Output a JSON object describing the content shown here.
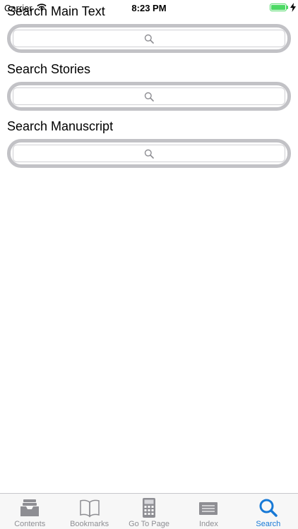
{
  "status_bar": {
    "carrier": "Carrier",
    "time": "8:23 PM"
  },
  "sections": [
    {
      "title": "Search Main Text"
    },
    {
      "title": "Search Stories"
    },
    {
      "title": "Search Manuscript"
    }
  ],
  "tab_bar": {
    "tabs": [
      {
        "label": "Contents",
        "icon": "inbox-tray-icon"
      },
      {
        "label": "Bookmarks",
        "icon": "open-book-icon"
      },
      {
        "label": "Go To Page",
        "icon": "calculator-icon"
      },
      {
        "label": "Index",
        "icon": "index-card-icon"
      },
      {
        "label": "Search",
        "icon": "search-icon"
      }
    ],
    "active_tab": "Search"
  },
  "colors": {
    "accent": "#1779d6",
    "inactive": "#8e8e93",
    "search_border": "#c2c2c6",
    "battery": "#4cd964"
  }
}
